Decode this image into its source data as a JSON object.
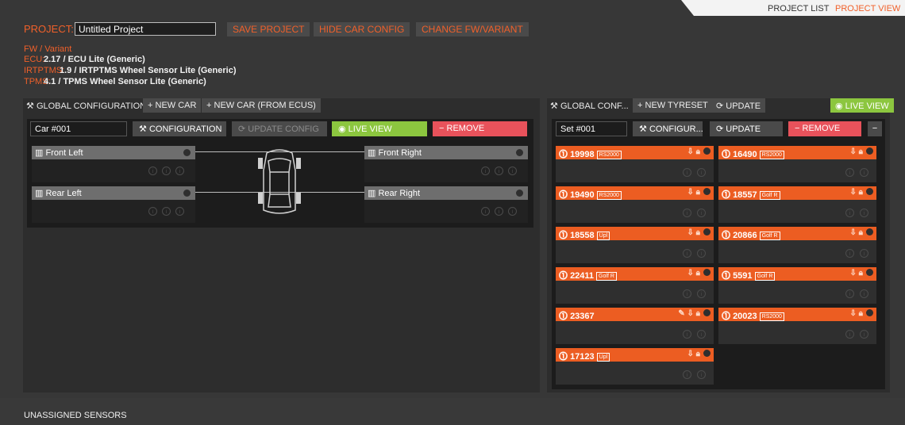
{
  "nav": {
    "project_list": "PROJECT LIST",
    "project_view": "PROJECT VIEW"
  },
  "project": {
    "label": "PROJECT:",
    "name": "Untitled Project",
    "buttons": [
      "SAVE PROJECT",
      "HIDE CAR CONFIG",
      "CHANGE FW/VARIANT"
    ]
  },
  "fw": {
    "title": "FW / Variant",
    "rows": [
      {
        "key": "ECU:",
        "value": "2.17 / ECU Lite (Generic)"
      },
      {
        "key": "IRTPTMS:",
        "value": "1.9 / IRTPTMS Wheel Sensor Lite (Generic)"
      },
      {
        "key": "TPMS:",
        "value": "4.1 / TPMS Wheel Sensor Lite (Generic)"
      }
    ]
  },
  "car_panel": {
    "title": "GLOBAL CONFIGURATION",
    "new_car": "NEW CAR",
    "new_car_ecus": "NEW CAR (FROM ECUS)",
    "car_name": "Car #001",
    "configuration": "CONFIGURATION",
    "update_config": "UPDATE CONFIG",
    "live_view": "LIVE VIEW",
    "remove": "REMOVE",
    "wheels": {
      "fl": "Front Left",
      "fr": "Front Right",
      "rl": "Rear Left",
      "rr": "Rear Right"
    }
  },
  "tyre_panel": {
    "title": "GLOBAL CONF...",
    "new_tyreset": "NEW TYRESET",
    "update": "UPDATE",
    "live_view": "LIVE VIEW",
    "set_name": "Set #001",
    "configure": "CONFIGUR...",
    "update2": "UPDATE",
    "remove": "REMOVE",
    "minus": "−",
    "tyres": [
      {
        "id": "19998",
        "tag": "RS2000"
      },
      {
        "id": "16490",
        "tag": "RS2000"
      },
      {
        "id": "19490",
        "tag": "RS2000"
      },
      {
        "id": "18557",
        "tag": "Golf R"
      },
      {
        "id": "18558",
        "tag": "Upl"
      },
      {
        "id": "20866",
        "tag": "Golf R"
      },
      {
        "id": "22411",
        "tag": "Golf R"
      },
      {
        "id": "5591",
        "tag": "Golf R"
      },
      {
        "id": "23367",
        "tag": ""
      },
      {
        "id": "20023",
        "tag": "RS2000"
      },
      {
        "id": "17123",
        "tag": "Upl"
      }
    ]
  },
  "unassigned": "UNASSIGNED SENSORS",
  "colors": {
    "accent": "#f0602a",
    "live": "#8cc63f",
    "remove": "#e8525b",
    "tyre": "#ec5d22"
  }
}
